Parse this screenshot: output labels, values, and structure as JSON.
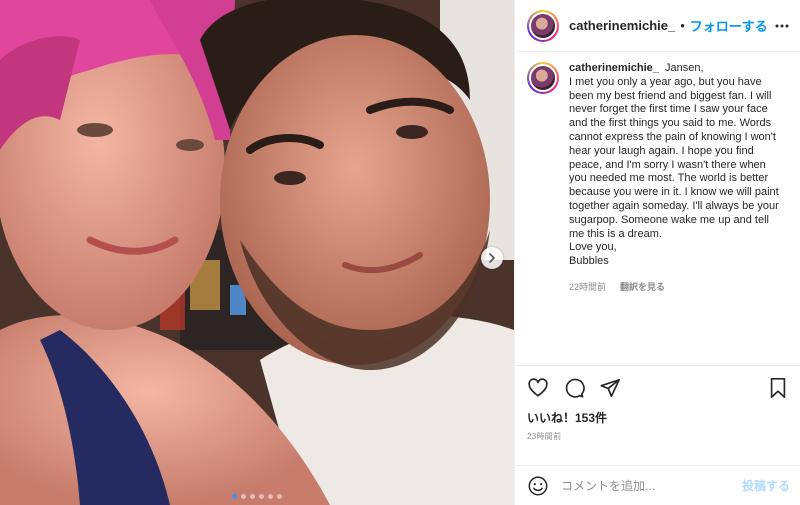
{
  "post": {
    "username": "catherinemichie_",
    "separator": "•",
    "follow_label": "フォローする",
    "caption_text": "Jansen,\nI met you only a year ago, but you have been my best friend and biggest fan. I will never forget the first time I saw your face and the first things you said to me. Words cannot express the pain of knowing I won't hear your laugh again. I hope you find peace, and I'm sorry I wasn't there when you needed me most. The world is better because you were in it. I know we will paint together again someday. I'll always be your sugarpop. Someone wake me up and tell me this is a dream.\nLove you,\nBubbles",
    "caption_time": "22時間前",
    "see_translation": "翻訳を見る",
    "likes": "いいね！153件",
    "post_time": "23時間前",
    "comment_placeholder": "コメントを追加...",
    "post_button": "投稿する"
  },
  "carousel": {
    "slide_count": 6,
    "active_index": 0
  },
  "icons": {
    "more": "more-horizontal-icon",
    "like": "heart-icon",
    "comment": "comment-icon",
    "share": "paper-plane-icon",
    "save": "bookmark-icon",
    "emoji": "smiley-icon",
    "next": "chevron-right-icon"
  },
  "colors": {
    "follow": "#0095f6",
    "post_button_disabled": "#b3dbff",
    "muted_text": "#8e8e8e",
    "active_dot": "#3897f0"
  }
}
